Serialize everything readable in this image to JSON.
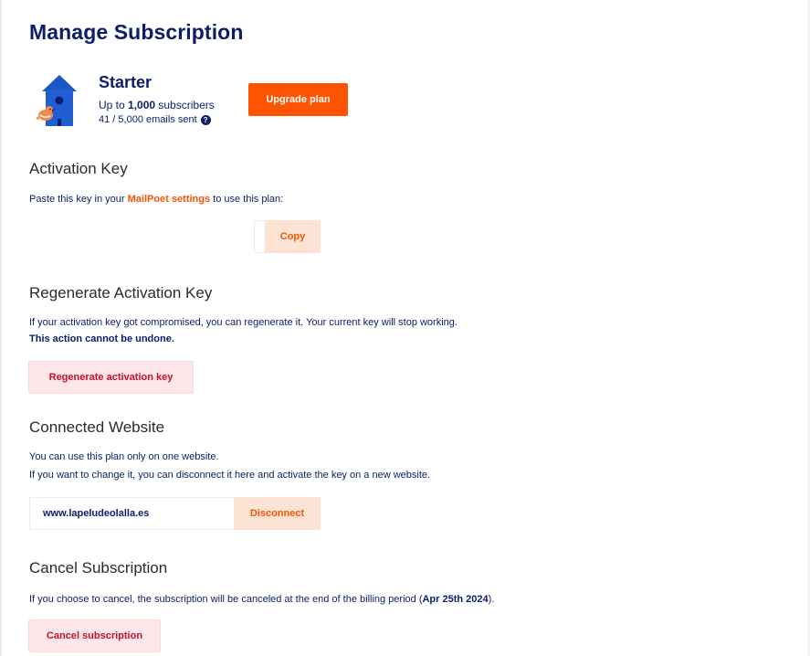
{
  "page": {
    "title": "Manage Subscription"
  },
  "plan": {
    "name": "Starter",
    "subscribers_prefix": "Up to ",
    "subscribers_count": "1,000",
    "subscribers_suffix": " subscribers",
    "emails_sent": "41 / 5,000 emails sent",
    "help_icon_glyph": "?",
    "upgrade_label": "Upgrade plan",
    "logo_icon": "birdhouse-icon"
  },
  "activation": {
    "title": "Activation Key",
    "text_prefix": "Paste this key in your ",
    "link_label": "MailPoet settings",
    "text_suffix": " to use this plan:",
    "key_value": "",
    "copy_label": "Copy"
  },
  "regenerate": {
    "title": "Regenerate Activation Key",
    "text": "If your activation key got compromised, you can regenerate it. Your current key will stop working.",
    "warning": "This action cannot be undone.",
    "button_label": "Regenerate activation key"
  },
  "website": {
    "title": "Connected Website",
    "line1": "You can use this plan only on one website.",
    "line2": "If you want to change it, you can disconnect it here and activate the key on a new website.",
    "url": "www.lapeludeolalla.es",
    "disconnect_label": "Disconnect"
  },
  "cancel": {
    "title": "Cancel Subscription",
    "text_prefix": "If you choose to cancel, the subscription will be canceled at the end of the billing period (",
    "date": "Apr 25th 2024",
    "text_suffix": ").",
    "button_label": "Cancel subscription"
  },
  "colors": {
    "navy": "#0b1d6b",
    "orange": "#fe5301",
    "soft_orange": "#fde3d3",
    "soft_red": "#fde7ea",
    "red": "#c8102e"
  }
}
